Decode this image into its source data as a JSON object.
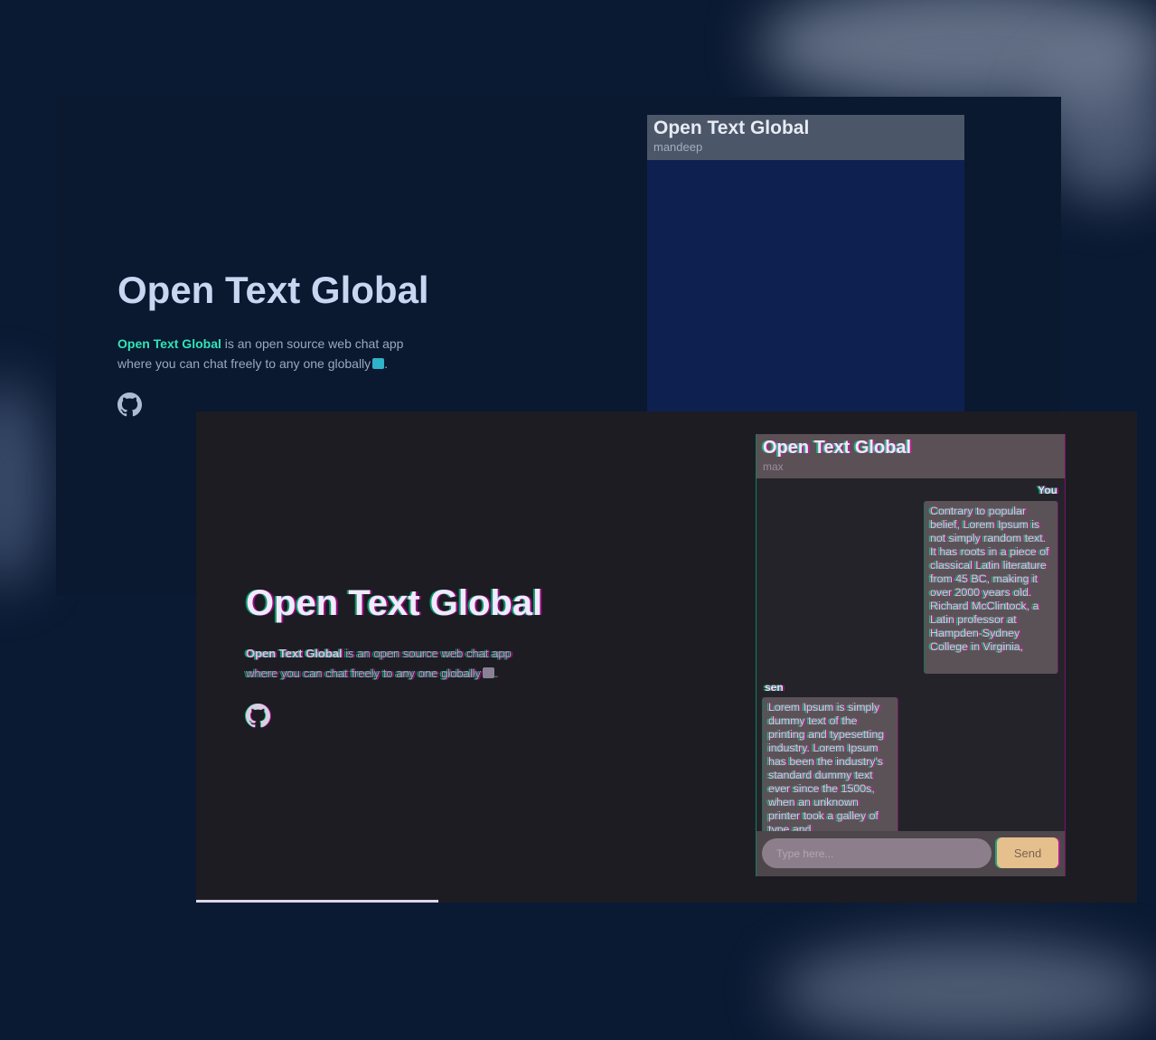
{
  "back_window": {
    "hero_title": "Open Text Global",
    "brand_name": "Open Text Global",
    "desc_line1_rest": " is an open source web chat app",
    "desc_line2": "where you can chat freely to any one globally",
    "desc_end": ".",
    "github_icon": "github-icon",
    "chat": {
      "title": "Open Text Global",
      "user": "mandeep"
    }
  },
  "front_window": {
    "hero_title": "Open Text Global",
    "brand_name": "Open Text Global",
    "desc_line1_rest": " is an open source web chat app",
    "desc_line2": "where you can chat freely to any one globally",
    "desc_end": ".",
    "github_icon": "github-icon",
    "chat": {
      "title": "Open Text Global",
      "user": "max",
      "messages": [
        {
          "sender": "You",
          "text": "Contrary to popular belief, Lorem Ipsum is not simply random text. It has roots in a piece of classical Latin literature from 45 BC, making it over 2000 years old. Richard McClintock, a Latin professor at Hampden-Sydney College in Virginia,"
        },
        {
          "sender": "sen",
          "text": "Lorem Ipsum is simply dummy text of the printing and typesetting industry. Lorem Ipsum has been the industry's standard dummy text ever since the 1500s, when an unknown printer took a galley of type and"
        }
      ],
      "input_placeholder": "Type here...",
      "send_label": "Send"
    }
  },
  "colors": {
    "brand_accent": "#2ee6b7",
    "send_button": "#e6c08c"
  }
}
